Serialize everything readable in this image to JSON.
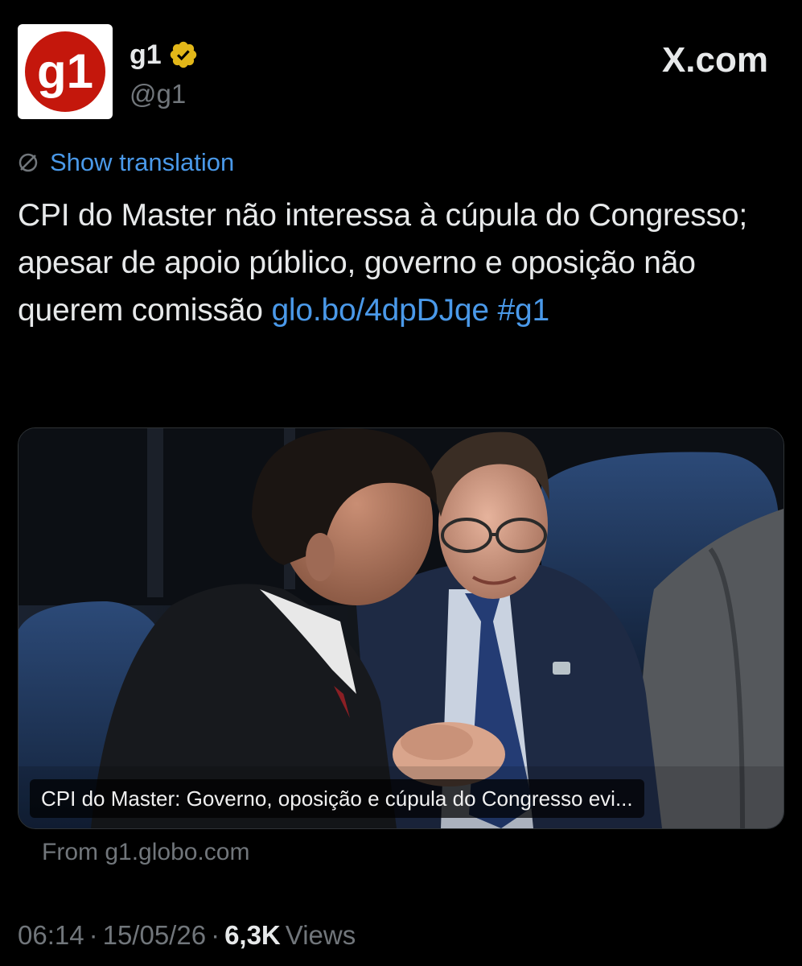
{
  "author": {
    "avatar_text": "g1",
    "name": "g1",
    "handle": "@g1",
    "verified_icon": "verified-gold-badge-icon"
  },
  "watermark": "X.com",
  "translation_label": "Show translation",
  "tweet": {
    "text": "CPI do Master não interessa à cúpula do Congresso; apesar de apoio público, governo e oposição não querem comissão ",
    "link": "glo.bo/4dpDJqe",
    "hashtag": "#g1"
  },
  "card": {
    "caption": "CPI do Master: Governo, oposição e cúpula do Congresso evi...",
    "source": "From g1.globo.com"
  },
  "meta": {
    "time": "06:14",
    "separator": "·",
    "date": "15/05/26",
    "views_count": "6,3K",
    "views_label": "Views"
  },
  "colors": {
    "background": "#000000",
    "link": "#4a99e9",
    "muted": "#71767b",
    "brand_red": "#c4170c",
    "badge_gold": "#e2b719"
  }
}
